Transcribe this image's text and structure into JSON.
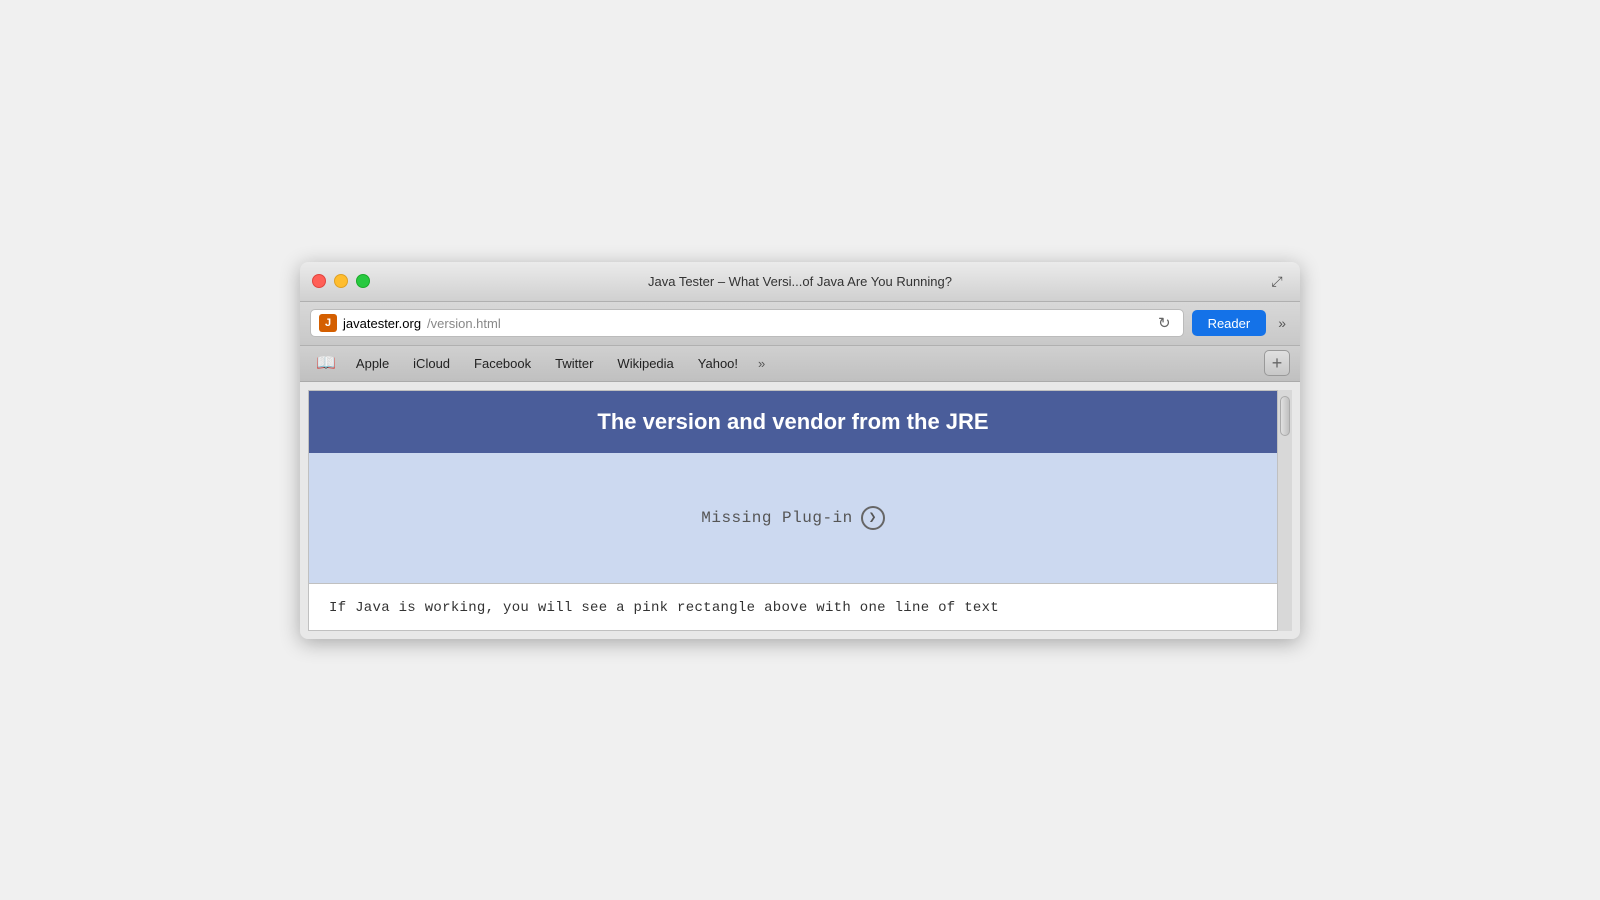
{
  "window": {
    "title": "Java Tester – What Versi...of Java Are You Running?",
    "traffic_lights": {
      "close_label": "close",
      "minimize_label": "minimize",
      "maximize_label": "maximize"
    }
  },
  "address_bar": {
    "site_icon_letter": "J",
    "url_domain": "javatester.org",
    "url_path": "/version.html",
    "reader_label": "Reader"
  },
  "bookmarks": {
    "items": [
      {
        "label": "Apple"
      },
      {
        "label": "iCloud"
      },
      {
        "label": "Facebook"
      },
      {
        "label": "Twitter"
      },
      {
        "label": "Wikipedia"
      },
      {
        "label": "Yahoo!"
      }
    ],
    "overflow_label": "»",
    "new_tab_label": "+"
  },
  "page": {
    "header_text": "The version and vendor from the JRE",
    "missing_plugin_text": "Missing Plug-in",
    "footer_text": "If Java is working, you will see a pink rectangle above with one line of text"
  },
  "icons": {
    "bookmarks_icon": "📖",
    "reload_icon": "↻",
    "nav_arrows": "»",
    "expand_icon": "⤢",
    "plugin_arrow": "❯"
  }
}
